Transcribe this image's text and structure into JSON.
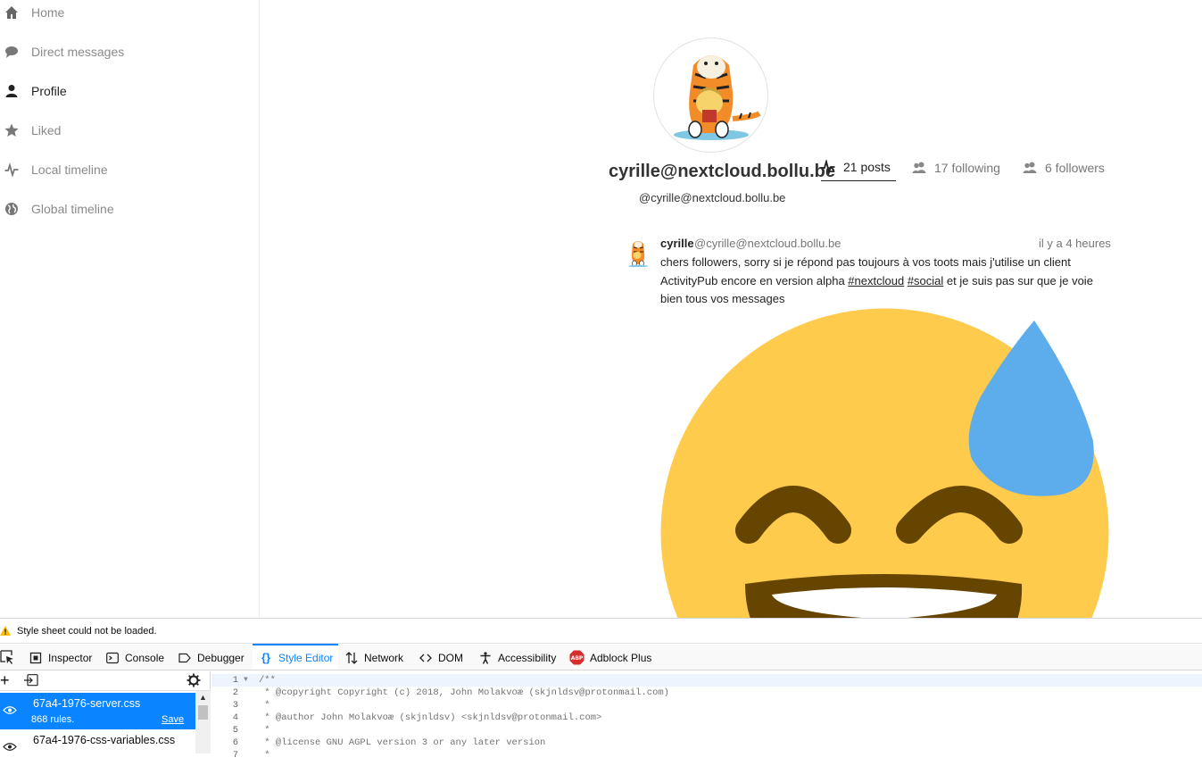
{
  "sidebar": {
    "items": [
      {
        "label": "Home",
        "icon": "home-icon"
      },
      {
        "label": "Direct messages",
        "icon": "speech-bubble-icon"
      },
      {
        "label": "Profile",
        "icon": "user-icon"
      },
      {
        "label": "Liked",
        "icon": "star-icon"
      },
      {
        "label": "Local timeline",
        "icon": "activity-icon"
      },
      {
        "label": "Global timeline",
        "icon": "globe-icon"
      }
    ]
  },
  "profile": {
    "display_name": "cyrille@nextcloud.bollu.be",
    "account": "@cyrille@nextcloud.bollu.be",
    "stats": {
      "posts": "21 posts",
      "following": "17 following",
      "followers": "6 followers"
    }
  },
  "post": {
    "author": "cyrille",
    "handle": "@cyrille@nextcloud.bollu.be",
    "time": "il y a 4 heures",
    "text_before": "chers followers, sorry si je répond pas toujours à vos toots mais j'utilise un client ActivityPub encore en version alpha ",
    "tag1": "#nextcloud",
    "tag2": "#social",
    "text_after": " et je suis pas sur que je voie bien tous vos messages",
    "emoji": "grinning-face-with-sweat-emoji"
  },
  "devtools": {
    "warning": "Style sheet could not be loaded.",
    "tabs": {
      "inspector": "Inspector",
      "console": "Console",
      "debugger": "Debugger",
      "style_editor": "Style Editor",
      "network": "Network",
      "dom": "DOM",
      "accessibility": "Accessibility",
      "adblock": "Adblock Plus"
    },
    "sheets": [
      {
        "name": "67a4-1976-server.css",
        "rules": "868 rules.",
        "save": "Save"
      },
      {
        "name": "67a4-1976-css-variables.css"
      }
    ],
    "code_lines": [
      {
        "n": "1",
        "text": "/**"
      },
      {
        "n": "2",
        "text": " * @copyright Copyright (c) 2018, John Molakvoæ (skjnldsv@protonmail.com)"
      },
      {
        "n": "3",
        "text": " *"
      },
      {
        "n": "4",
        "text": " * @author John Molakvoæ (skjnldsv) <skjnldsv@protonmail.com>"
      },
      {
        "n": "5",
        "text": " *"
      },
      {
        "n": "6",
        "text": " * @license GNU AGPL version 3 or any later version"
      },
      {
        "n": "7",
        "text": " *"
      }
    ]
  },
  "colors": {
    "accent": "#0a84ff",
    "emoji_face": "#ffcb4c",
    "emoji_drop": "#5dadec",
    "emoji_features": "#664500"
  }
}
